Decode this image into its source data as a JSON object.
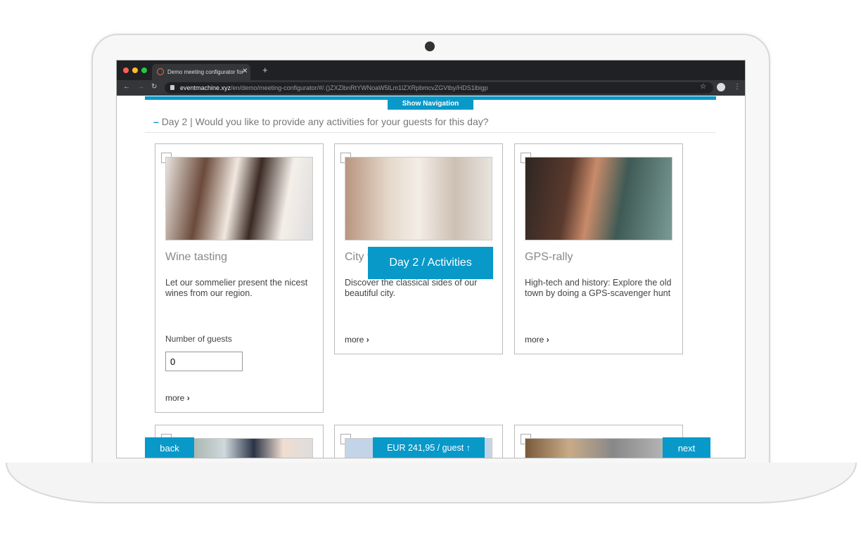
{
  "browser": {
    "tab_title": "Demo meeting configurator for",
    "url_host": "eventmachine.xyz",
    "url_path": "/en/demo/meeting-configurator/#/.()ZXZlbnRtYWNoaW5lLm1lZXRpbmcvZGVtby/HDS1lbigp"
  },
  "nav": {
    "show_navigation": "Show Navigation"
  },
  "section": {
    "title": "Day 2 | Would you like to provide any activities for your guests for this day?"
  },
  "overlay": {
    "label": "Day 2 / Activities"
  },
  "cards": [
    {
      "title": "Wine tasting",
      "description": "Let our sommelier present the nicest wines from our region.",
      "guests_label": "Number of guests",
      "guests_value": "0",
      "more": "more"
    },
    {
      "title": "City t",
      "description": "Discover the classical sides of our beautiful city.",
      "more": "more"
    },
    {
      "title": "GPS-rally",
      "description": "High-tech and history: Explore the old town by doing a GPS-scavenger hunt",
      "more": "more"
    }
  ],
  "footer": {
    "back": "back",
    "price": "EUR 241,95 / guest",
    "next": "next"
  },
  "colors": {
    "accent": "#0899c9"
  }
}
